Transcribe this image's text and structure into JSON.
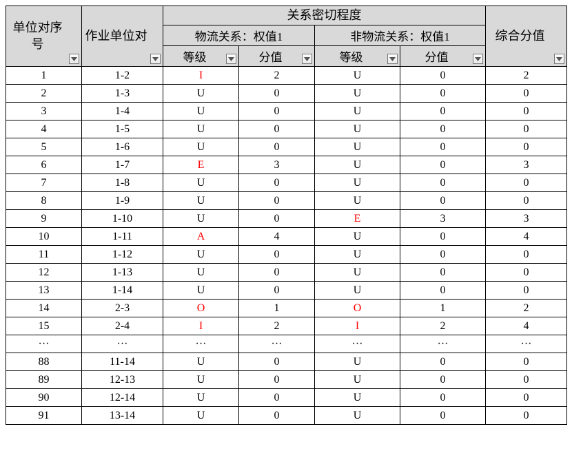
{
  "headers": {
    "seq": "单位对序号",
    "pair": "作业单位对",
    "closeness": "关系密切程度",
    "logistics": "物流关系：权值1",
    "nonlogistics": "非物流关系：权值1",
    "grade": "等级",
    "score": "分值",
    "total": "综合分值"
  },
  "ellipsis": "···",
  "rows": [
    {
      "seq": "1",
      "pair": "1-2",
      "g1": "I",
      "v1": "2",
      "g2": "U",
      "v2": "0",
      "total": "2",
      "g1red": true
    },
    {
      "seq": "2",
      "pair": "1-3",
      "g1": "U",
      "v1": "0",
      "g2": "U",
      "v2": "0",
      "total": "0"
    },
    {
      "seq": "3",
      "pair": "1-4",
      "g1": "U",
      "v1": "0",
      "g2": "U",
      "v2": "0",
      "total": "0"
    },
    {
      "seq": "4",
      "pair": "1-5",
      "g1": "U",
      "v1": "0",
      "g2": "U",
      "v2": "0",
      "total": "0"
    },
    {
      "seq": "5",
      "pair": "1-6",
      "g1": "U",
      "v1": "0",
      "g2": "U",
      "v2": "0",
      "total": "0"
    },
    {
      "seq": "6",
      "pair": "1-7",
      "g1": "E",
      "v1": "3",
      "g2": "U",
      "v2": "0",
      "total": "3",
      "g1red": true
    },
    {
      "seq": "7",
      "pair": "1-8",
      "g1": "U",
      "v1": "0",
      "g2": "U",
      "v2": "0",
      "total": "0"
    },
    {
      "seq": "8",
      "pair": "1-9",
      "g1": "U",
      "v1": "0",
      "g2": "U",
      "v2": "0",
      "total": "0"
    },
    {
      "seq": "9",
      "pair": "1-10",
      "g1": "U",
      "v1": "0",
      "g2": "E",
      "v2": "3",
      "total": "3",
      "g2red": true
    },
    {
      "seq": "10",
      "pair": "1-11",
      "g1": "A",
      "v1": "4",
      "g2": "U",
      "v2": "0",
      "total": "4",
      "g1red": true
    },
    {
      "seq": "11",
      "pair": "1-12",
      "g1": "U",
      "v1": "0",
      "g2": "U",
      "v2": "0",
      "total": "0"
    },
    {
      "seq": "12",
      "pair": "1-13",
      "g1": "U",
      "v1": "0",
      "g2": "U",
      "v2": "0",
      "total": "0"
    },
    {
      "seq": "13",
      "pair": "1-14",
      "g1": "U",
      "v1": "0",
      "g2": "U",
      "v2": "0",
      "total": "0"
    },
    {
      "seq": "14",
      "pair": "2-3",
      "g1": "O",
      "v1": "1",
      "g2": "O",
      "v2": "1",
      "total": "2",
      "g1red": true,
      "g2red": true
    },
    {
      "seq": "15",
      "pair": "2-4",
      "g1": "I",
      "v1": "2",
      "g2": "I",
      "v2": "2",
      "total": "4",
      "g1red": true,
      "g2red": true
    },
    {
      "ellipsis": true
    },
    {
      "seq": "88",
      "pair": "11-14",
      "g1": "U",
      "v1": "0",
      "g2": "U",
      "v2": "0",
      "total": "0"
    },
    {
      "seq": "89",
      "pair": "12-13",
      "g1": "U",
      "v1": "0",
      "g2": "U",
      "v2": "0",
      "total": "0"
    },
    {
      "seq": "90",
      "pair": "12-14",
      "g1": "U",
      "v1": "0",
      "g2": "U",
      "v2": "0",
      "total": "0"
    },
    {
      "seq": "91",
      "pair": "13-14",
      "g1": "U",
      "v1": "0",
      "g2": "U",
      "v2": "0",
      "total": "0"
    }
  ]
}
